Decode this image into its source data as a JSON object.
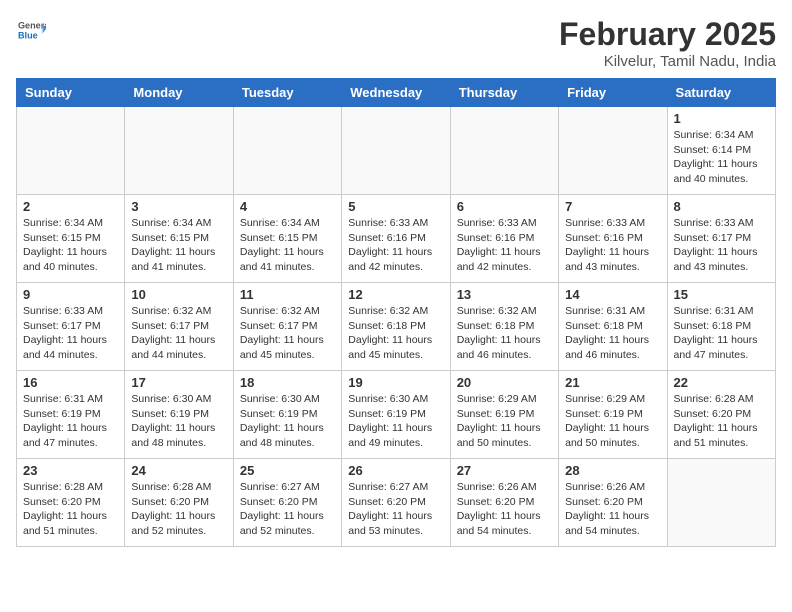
{
  "header": {
    "logo_general": "General",
    "logo_blue": "Blue",
    "month_title": "February 2025",
    "location": "Kilvelur, Tamil Nadu, India"
  },
  "weekdays": [
    "Sunday",
    "Monday",
    "Tuesday",
    "Wednesday",
    "Thursday",
    "Friday",
    "Saturday"
  ],
  "weeks": [
    [
      {
        "day": "",
        "info": ""
      },
      {
        "day": "",
        "info": ""
      },
      {
        "day": "",
        "info": ""
      },
      {
        "day": "",
        "info": ""
      },
      {
        "day": "",
        "info": ""
      },
      {
        "day": "",
        "info": ""
      },
      {
        "day": "1",
        "info": "Sunrise: 6:34 AM\nSunset: 6:14 PM\nDaylight: 11 hours\nand 40 minutes."
      }
    ],
    [
      {
        "day": "2",
        "info": "Sunrise: 6:34 AM\nSunset: 6:15 PM\nDaylight: 11 hours\nand 40 minutes."
      },
      {
        "day": "3",
        "info": "Sunrise: 6:34 AM\nSunset: 6:15 PM\nDaylight: 11 hours\nand 41 minutes."
      },
      {
        "day": "4",
        "info": "Sunrise: 6:34 AM\nSunset: 6:15 PM\nDaylight: 11 hours\nand 41 minutes."
      },
      {
        "day": "5",
        "info": "Sunrise: 6:33 AM\nSunset: 6:16 PM\nDaylight: 11 hours\nand 42 minutes."
      },
      {
        "day": "6",
        "info": "Sunrise: 6:33 AM\nSunset: 6:16 PM\nDaylight: 11 hours\nand 42 minutes."
      },
      {
        "day": "7",
        "info": "Sunrise: 6:33 AM\nSunset: 6:16 PM\nDaylight: 11 hours\nand 43 minutes."
      },
      {
        "day": "8",
        "info": "Sunrise: 6:33 AM\nSunset: 6:17 PM\nDaylight: 11 hours\nand 43 minutes."
      }
    ],
    [
      {
        "day": "9",
        "info": "Sunrise: 6:33 AM\nSunset: 6:17 PM\nDaylight: 11 hours\nand 44 minutes."
      },
      {
        "day": "10",
        "info": "Sunrise: 6:32 AM\nSunset: 6:17 PM\nDaylight: 11 hours\nand 44 minutes."
      },
      {
        "day": "11",
        "info": "Sunrise: 6:32 AM\nSunset: 6:17 PM\nDaylight: 11 hours\nand 45 minutes."
      },
      {
        "day": "12",
        "info": "Sunrise: 6:32 AM\nSunset: 6:18 PM\nDaylight: 11 hours\nand 45 minutes."
      },
      {
        "day": "13",
        "info": "Sunrise: 6:32 AM\nSunset: 6:18 PM\nDaylight: 11 hours\nand 46 minutes."
      },
      {
        "day": "14",
        "info": "Sunrise: 6:31 AM\nSunset: 6:18 PM\nDaylight: 11 hours\nand 46 minutes."
      },
      {
        "day": "15",
        "info": "Sunrise: 6:31 AM\nSunset: 6:18 PM\nDaylight: 11 hours\nand 47 minutes."
      }
    ],
    [
      {
        "day": "16",
        "info": "Sunrise: 6:31 AM\nSunset: 6:19 PM\nDaylight: 11 hours\nand 47 minutes."
      },
      {
        "day": "17",
        "info": "Sunrise: 6:30 AM\nSunset: 6:19 PM\nDaylight: 11 hours\nand 48 minutes."
      },
      {
        "day": "18",
        "info": "Sunrise: 6:30 AM\nSunset: 6:19 PM\nDaylight: 11 hours\nand 48 minutes."
      },
      {
        "day": "19",
        "info": "Sunrise: 6:30 AM\nSunset: 6:19 PM\nDaylight: 11 hours\nand 49 minutes."
      },
      {
        "day": "20",
        "info": "Sunrise: 6:29 AM\nSunset: 6:19 PM\nDaylight: 11 hours\nand 50 minutes."
      },
      {
        "day": "21",
        "info": "Sunrise: 6:29 AM\nSunset: 6:19 PM\nDaylight: 11 hours\nand 50 minutes."
      },
      {
        "day": "22",
        "info": "Sunrise: 6:28 AM\nSunset: 6:20 PM\nDaylight: 11 hours\nand 51 minutes."
      }
    ],
    [
      {
        "day": "23",
        "info": "Sunrise: 6:28 AM\nSunset: 6:20 PM\nDaylight: 11 hours\nand 51 minutes."
      },
      {
        "day": "24",
        "info": "Sunrise: 6:28 AM\nSunset: 6:20 PM\nDaylight: 11 hours\nand 52 minutes."
      },
      {
        "day": "25",
        "info": "Sunrise: 6:27 AM\nSunset: 6:20 PM\nDaylight: 11 hours\nand 52 minutes."
      },
      {
        "day": "26",
        "info": "Sunrise: 6:27 AM\nSunset: 6:20 PM\nDaylight: 11 hours\nand 53 minutes."
      },
      {
        "day": "27",
        "info": "Sunrise: 6:26 AM\nSunset: 6:20 PM\nDaylight: 11 hours\nand 54 minutes."
      },
      {
        "day": "28",
        "info": "Sunrise: 6:26 AM\nSunset: 6:20 PM\nDaylight: 11 hours\nand 54 minutes."
      },
      {
        "day": "",
        "info": ""
      }
    ]
  ]
}
